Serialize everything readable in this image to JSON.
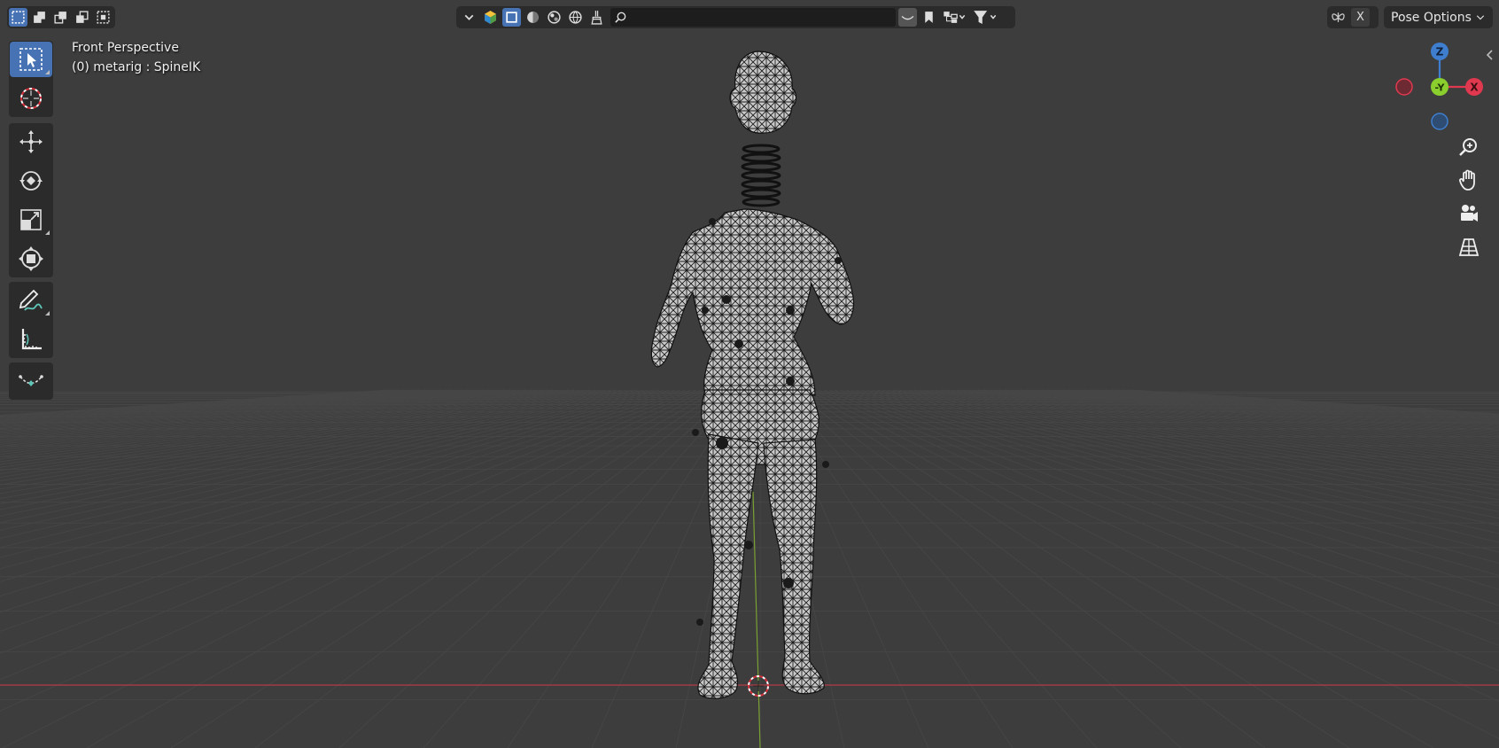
{
  "viewport": {
    "view_name": "Front Perspective",
    "object_info": "(0) metarig : SpineIK"
  },
  "header": {
    "select_modes": [
      {
        "name": "select-box-new-icon",
        "active": true
      },
      {
        "name": "select-box-extend-icon",
        "active": false
      },
      {
        "name": "select-box-subtract-icon",
        "active": false
      },
      {
        "name": "select-box-invert-icon",
        "active": false
      },
      {
        "name": "select-box-intersect-icon",
        "active": false
      }
    ],
    "search_placeholder": "",
    "close_label": "X",
    "pose_options_label": "Pose Options"
  },
  "toolbar": {
    "tools": [
      {
        "name": "select-box-tool",
        "icon": "cursor-select-icon",
        "active": true
      },
      {
        "name": "cursor-tool",
        "icon": "3d-cursor-icon",
        "active": false
      },
      {
        "name": "move-tool",
        "icon": "move-arrows-icon",
        "active": false
      },
      {
        "name": "rotate-tool",
        "icon": "rotate-icon",
        "active": false
      },
      {
        "name": "scale-tool",
        "icon": "scale-icon",
        "active": false
      },
      {
        "name": "transform-tool",
        "icon": "transform-icon",
        "active": false
      },
      {
        "name": "annotate-tool",
        "icon": "annotate-pencil-icon",
        "active": false
      },
      {
        "name": "measure-tool",
        "icon": "measure-ruler-icon",
        "active": false
      },
      {
        "name": "relax-tool",
        "icon": "relax-curve-icon",
        "active": false
      }
    ]
  },
  "gizmo": {
    "axes": [
      "Z",
      "-Y",
      "X"
    ],
    "colors": {
      "x": "#e0394f",
      "y": "#8bcf2f",
      "z": "#3f7ecf"
    }
  },
  "colors": {
    "background": "#3d3d3d",
    "grid_line": "#474747",
    "x_axis_line": "#b43c48",
    "y_axis_line": "#7aa033",
    "accent_active": "#4772b3",
    "panel": "#2b2b2b"
  }
}
